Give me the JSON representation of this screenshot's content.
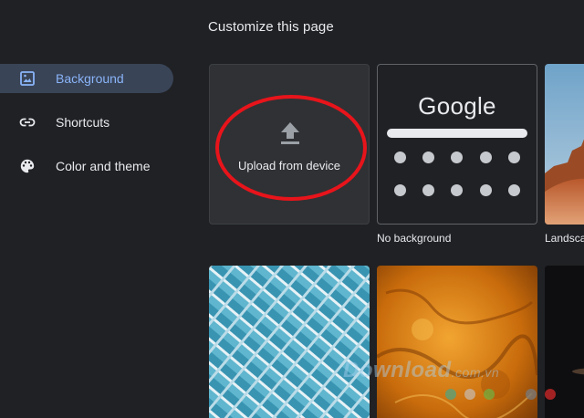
{
  "dialog": {
    "title": "Customize this page"
  },
  "sidebar": {
    "items": [
      {
        "label": "Background",
        "icon": "image-icon",
        "active": true
      },
      {
        "label": "Shortcuts",
        "icon": "link-icon",
        "active": false
      },
      {
        "label": "Color and theme",
        "icon": "palette-icon",
        "active": false
      }
    ]
  },
  "tiles": {
    "upload_label": "Upload from device",
    "no_background_preview_word": "Google",
    "no_background_label": "No background",
    "landscape_label": "Landsca"
  },
  "annotation": {
    "color": "#e8141b",
    "shape": "ellipse around upload tile"
  },
  "watermark": {
    "text": "Download",
    "suffix": ".com.vn"
  },
  "colors": {
    "background": "#202124",
    "active_item_bg": "#394457",
    "active_item_text": "#8ab4f8",
    "tile_bg": "#303134"
  }
}
